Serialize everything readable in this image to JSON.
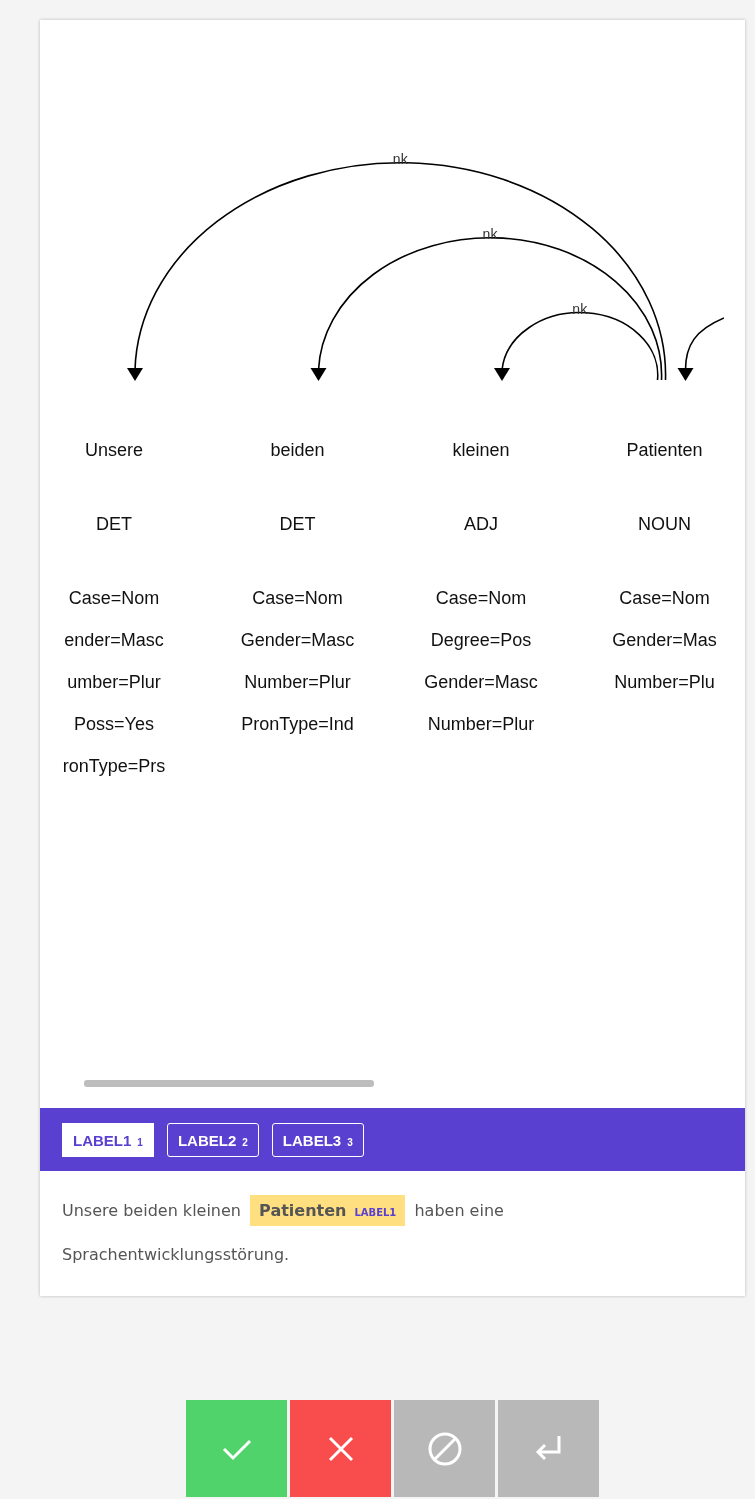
{
  "tokens": [
    {
      "word": "Unsere",
      "tag": "DET",
      "features": [
        "Case=Nom",
        "ender=Masc",
        "umber=Plur",
        "Poss=Yes",
        "ronType=Prs"
      ],
      "arc": {
        "kind": "full",
        "label": "nk"
      }
    },
    {
      "word": "beiden",
      "tag": "DET",
      "features": [
        "Case=Nom",
        "Gender=Masc",
        "Number=Plur",
        "PronType=Ind"
      ],
      "arc": {
        "kind": "full",
        "label": "nk"
      }
    },
    {
      "word": "kleinen",
      "tag": "ADJ",
      "features": [
        "Case=Nom",
        "Degree=Pos",
        "Gender=Masc",
        "Number=Plur"
      ],
      "arc": {
        "kind": "full",
        "label": "nk"
      }
    },
    {
      "word": "Patienten",
      "tag": "NOUN",
      "features": [
        "Case=Nom",
        "Gender=Mas",
        "Number=Plu"
      ],
      "arc": {
        "kind": "partial"
      }
    }
  ],
  "labels": [
    {
      "text": "LABEL1",
      "hotkey": "1",
      "selected": true
    },
    {
      "text": "LABEL2",
      "hotkey": "2",
      "selected": false
    },
    {
      "text": "LABEL3",
      "hotkey": "3",
      "selected": false
    }
  ],
  "sentence": {
    "before": "Unsere beiden kleinen",
    "entity": {
      "text": "Patienten",
      "label": "LABEL1"
    },
    "after": [
      "haben eine",
      "Sprachentwicklungsstörung."
    ]
  },
  "buttons": [
    {
      "kind": "accept"
    },
    {
      "kind": "reject"
    },
    {
      "kind": "skip"
    },
    {
      "kind": "submit"
    }
  ]
}
